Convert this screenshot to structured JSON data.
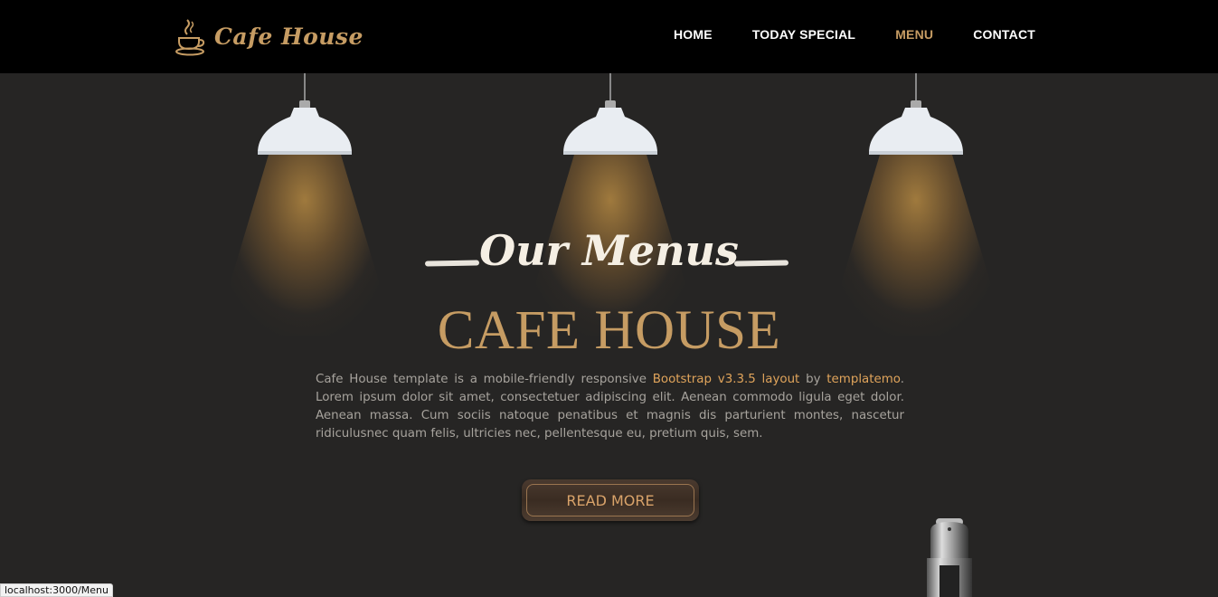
{
  "brand": {
    "logo_text": "Cafe House"
  },
  "nav": {
    "items": [
      {
        "label": "HOME",
        "active": false
      },
      {
        "label": "TODAY SPECIAL",
        "active": false
      },
      {
        "label": "MENU",
        "active": true
      },
      {
        "label": "CONTACT",
        "active": false
      }
    ]
  },
  "hero": {
    "script_title": "Our Menus",
    "title": "CAFE HOUSE",
    "description_parts": {
      "p1": "Cafe House template is a mobile-friendly responsive ",
      "link1": "Bootstrap v3.3.5 layout",
      "p2": " by ",
      "link2": "templatemo",
      "p3": ". Lorem ipsum dolor sit amet, consectetuer adipiscing elit. Aenean commodo ligula eget dolor. Aenean massa. Cum sociis natoque penatibus et magnis dis parturient montes, nascetur ridiculusnec quam felis, ultricies nec, pellentesque eu, pretium quis, sem."
    },
    "button_label": "READ MORE"
  },
  "status_bar": {
    "url": "localhost:3000/Menu"
  },
  "colors": {
    "accent": "#c69c63",
    "background": "#262524",
    "header": "#000000"
  },
  "icons": [
    "coffee-cup-icon",
    "pendant-lamp",
    "coffee-machine"
  ]
}
